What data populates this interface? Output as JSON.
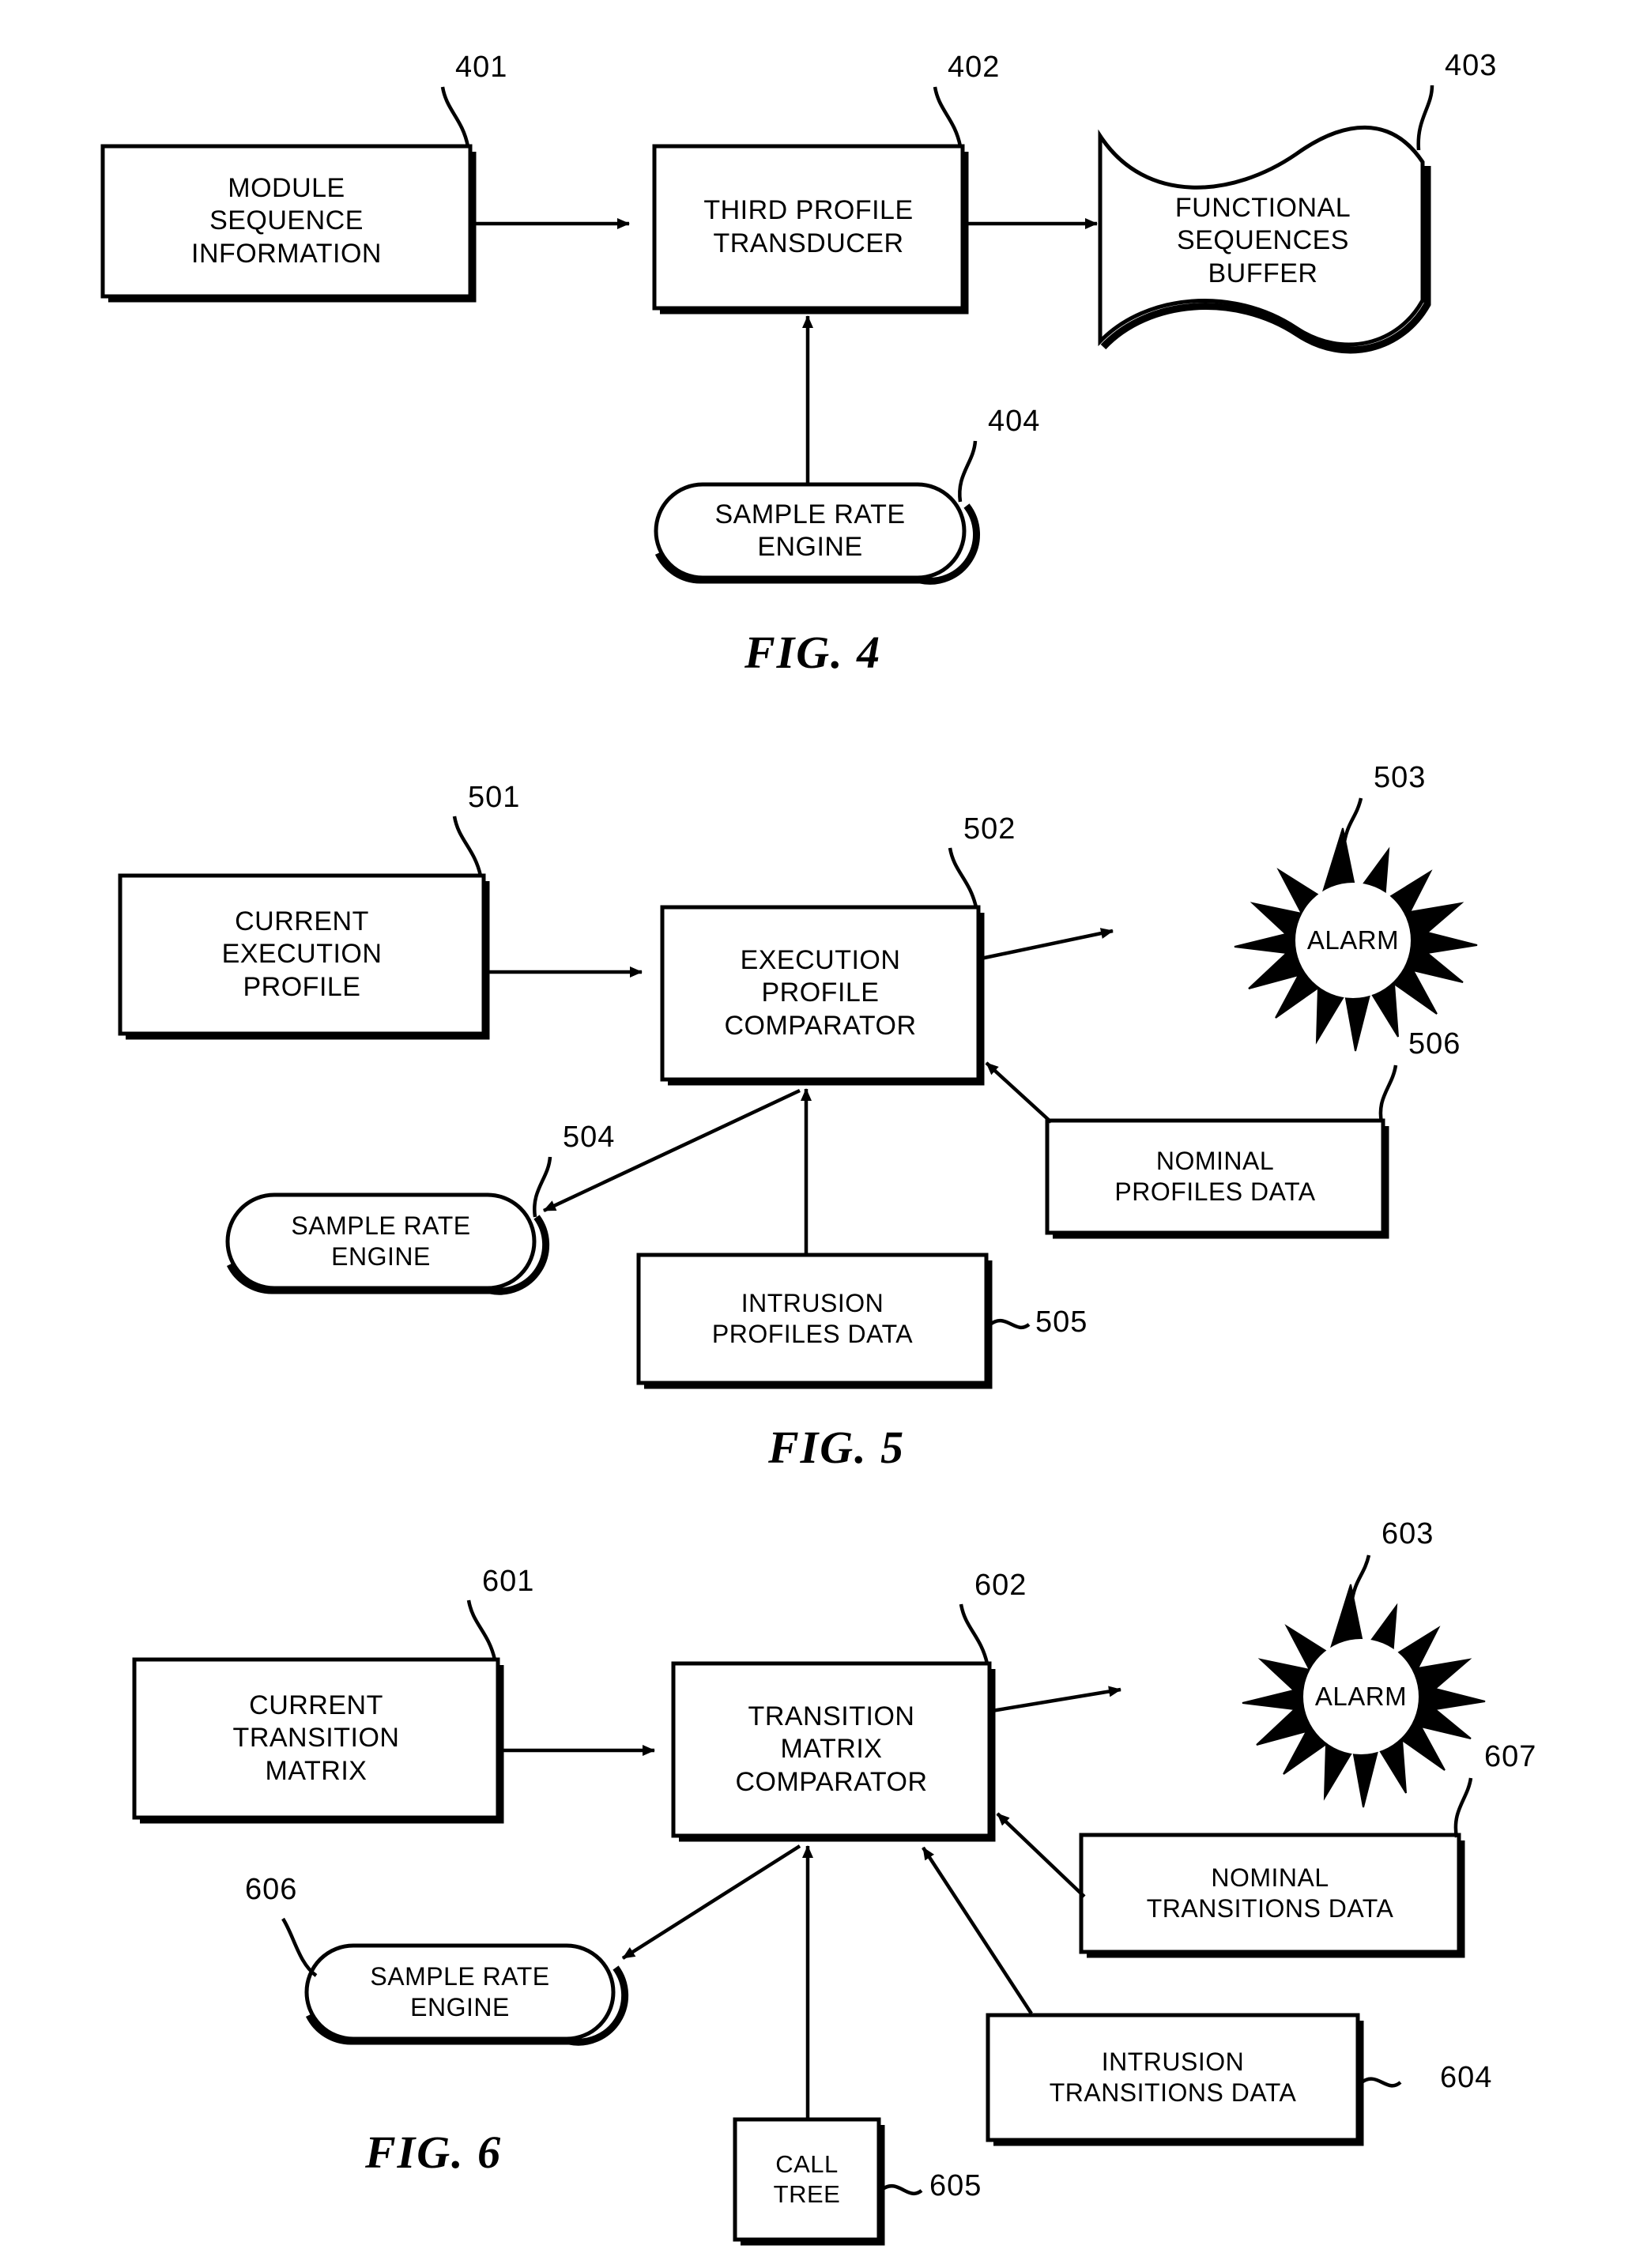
{
  "document": {
    "type": "patent-drawing-sheet",
    "figures": [
      "FIG. 4",
      "FIG. 5",
      "FIG. 6"
    ]
  },
  "fig4": {
    "label": "FIG. 4",
    "nodes": {
      "module_sequence_information": {
        "text": "MODULE\nSEQUENCE\nINFORMATION",
        "ref": "401",
        "shape": "rectangle"
      },
      "third_profile_transducer": {
        "text": "THIRD PROFILE\nTRANSDUCER",
        "ref": "402",
        "shape": "rectangle"
      },
      "functional_sequences_buffer": {
        "text": "FUNCTIONAL\nSEQUENCES\nBUFFER",
        "ref": "403",
        "shape": "wavy-document"
      },
      "sample_rate_engine": {
        "text": "SAMPLE RATE\nENGINE",
        "ref": "404",
        "shape": "stadium"
      }
    }
  },
  "fig5": {
    "label": "FIG. 5",
    "nodes": {
      "current_execution_profile": {
        "text": "CURRENT\nEXECUTION\nPROFILE",
        "ref": "501",
        "shape": "rectangle"
      },
      "execution_profile_comparator": {
        "text": "EXECUTION\nPROFILE\nCOMPARATOR",
        "ref": "502",
        "shape": "rectangle"
      },
      "alarm": {
        "text": "ALARM",
        "ref": "503",
        "shape": "starburst"
      },
      "sample_rate_engine": {
        "text": "SAMPLE RATE\nENGINE",
        "ref": "504",
        "shape": "stadium"
      },
      "intrusion_profiles_data": {
        "text": "INTRUSION\nPROFILES DATA",
        "ref": "505",
        "shape": "rectangle"
      },
      "nominal_profiles_data": {
        "text": "NOMINAL\nPROFILES DATA",
        "ref": "506",
        "shape": "rectangle"
      }
    }
  },
  "fig6": {
    "label": "FIG. 6",
    "nodes": {
      "current_transition_matrix": {
        "text": "CURRENT\nTRANSITION\nMATRIX",
        "ref": "601",
        "shape": "rectangle"
      },
      "transition_matrix_comparator": {
        "text": "TRANSITION\nMATRIX\nCOMPARATOR",
        "ref": "602",
        "shape": "rectangle"
      },
      "alarm": {
        "text": "ALARM",
        "ref": "603",
        "shape": "starburst"
      },
      "intrusion_transitions_data": {
        "text": "INTRUSION\nTRANSITIONS DATA",
        "ref": "604",
        "shape": "rectangle"
      },
      "call_tree": {
        "text": "CALL\nTREE",
        "ref": "605",
        "shape": "rectangle"
      },
      "sample_rate_engine": {
        "text": "SAMPLE RATE\nENGINE",
        "ref": "606",
        "shape": "stadium"
      },
      "nominal_transitions_data": {
        "text": "NOMINAL\nTRANSITIONS DATA",
        "ref": "607",
        "shape": "rectangle"
      }
    }
  },
  "colors": {
    "ink": "#000000",
    "paper": "#ffffff"
  }
}
